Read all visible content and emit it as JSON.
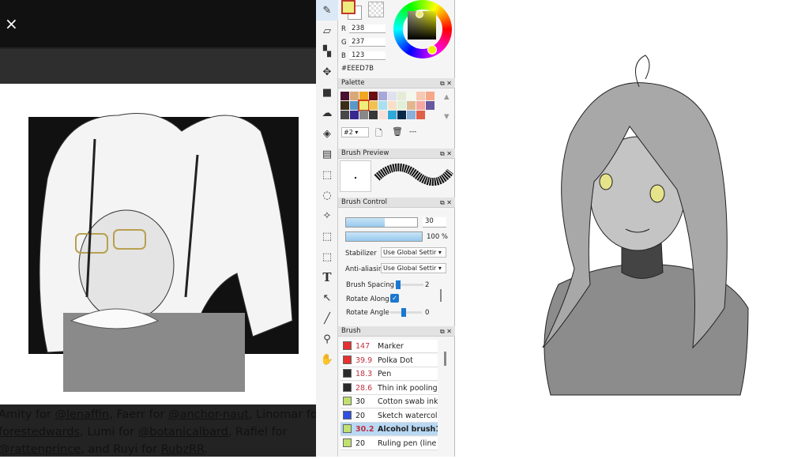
{
  "viewer": {
    "close_icon": "×",
    "caption": {
      "p1": "Amity for ",
      "l1": "@lenaffin",
      "p2": ", Faerr for ",
      "l2": "@anchor-naut",
      "p3": ", Linomar for",
      "l3": "forestedwards",
      "p4": ", Lumi for ",
      "l4": "@botanicalbard",
      "p5": ", Rafiel for",
      "l5": "@rattenprince",
      "p6": ", and Ruyi for ",
      "l6": "RubzRR",
      "p7": "."
    }
  },
  "color": {
    "primary": "#EEED7B",
    "r_label": "R",
    "r": "238",
    "g_label": "G",
    "g": "237",
    "b_label": "B",
    "b": "123",
    "hex": "#EEED7B"
  },
  "palette": {
    "title": "Palette",
    "swatches": [
      "#4a1030",
      "#d9a878",
      "#f0a820",
      "#6a1010",
      "#a8a8d8",
      "#e0e0ee",
      "#e4ecd8",
      "#f4f8ec",
      "#f8c8b0",
      "#f4a888",
      "#3a2e18",
      "#5a98c8",
      "#eeed7b",
      "#f0c050",
      "#a8e0f0",
      "#f8e0c8",
      "#e0f0d8",
      "#e0b890",
      "#f4a8a0",
      "#6858a0",
      "#484848",
      "#3a2890",
      "#888888",
      "#383838",
      "#f8e0d8",
      "#30a8d8",
      "#0a2848",
      "#88b0d8",
      "#e06048"
    ],
    "selected_index": 12,
    "set": "#2",
    "more": "---"
  },
  "brush_preview": {
    "title": "Brush Preview"
  },
  "brush_control": {
    "title": "Brush Control",
    "size": "30",
    "size_fraction": 0.54,
    "opacity": "100 %",
    "opacity_fraction": 1.0,
    "stabilizer_label": "Stabilizer",
    "stabilizer": "Use Global Settir",
    "antialias_label": "Anti-aliasir",
    "antialias": "Use Global Settir",
    "spacing_label": "Brush Spacing",
    "spacing": "2",
    "rotate_along_label": "Rotate Along",
    "rotate_angle_label": "Rotate Angle",
    "rotate_angle": "0"
  },
  "brush": {
    "title": "Brush",
    "items": [
      {
        "color": "#e83030",
        "size": "147",
        "name": "Marker",
        "red": true
      },
      {
        "color": "#e83030",
        "size": "39.9",
        "name": "Polka Dot",
        "red": true
      },
      {
        "color": "#2a2a2a",
        "size": "18.3",
        "name": "Pen",
        "red": true
      },
      {
        "color": "#2a2a2a",
        "size": "28.6",
        "name": "Thin ink pooling p",
        "red": true
      },
      {
        "color": "#c0e070",
        "size": "30",
        "name": "Cotton swab ink",
        "red": false
      },
      {
        "color": "#3050e0",
        "size": "20",
        "name": "Sketch watercol",
        "red": false
      },
      {
        "color": "#c0e070",
        "size": "30.2",
        "name": "Alcohol brush1",
        "red": true,
        "selected": true
      },
      {
        "color": "#c0e070",
        "size": "20",
        "name": "Ruling pen (line d",
        "red": false
      }
    ]
  }
}
